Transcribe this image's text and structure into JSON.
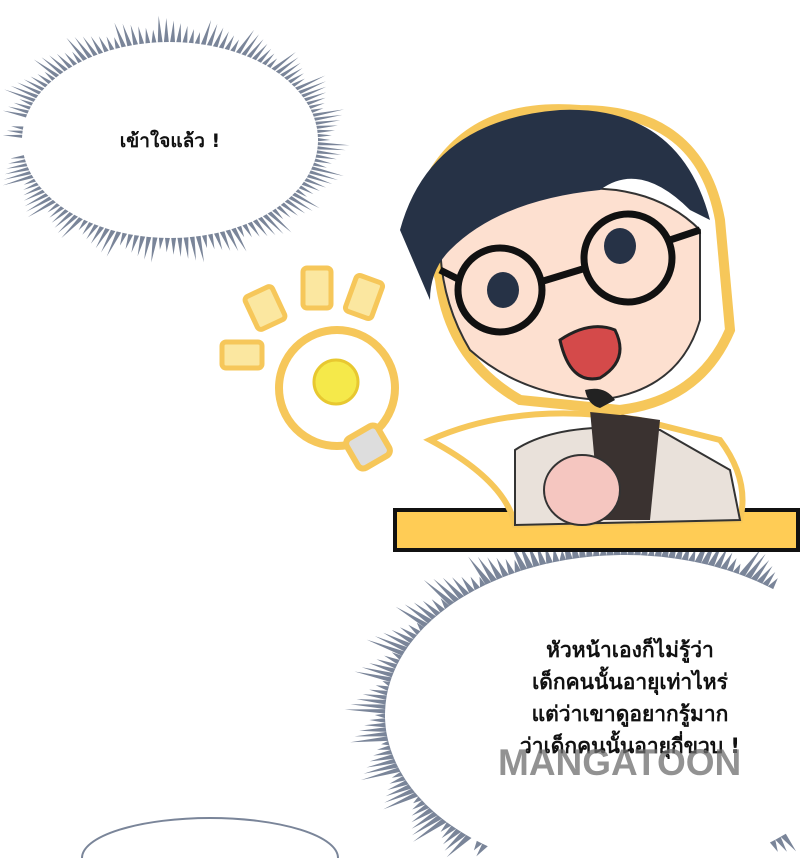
{
  "bubbles": {
    "top_left": "เข้าใจแล้ว !",
    "bottom_right": [
      "หัวหน้าเองก็ไม่รู้ว่า",
      "เด็กคนนั้นอายุเท่าไหร่",
      "แต่ว่าเขาดูอยากรู้มาก",
      "ว่าเด็กคนนั้นอายุกี่ขวบ !"
    ]
  },
  "watermark": "MANGATOON",
  "colors": {
    "spike": "#7a8599",
    "glow": "#f7d77a",
    "bulb": "#f5e94a",
    "hair": "#263246"
  }
}
